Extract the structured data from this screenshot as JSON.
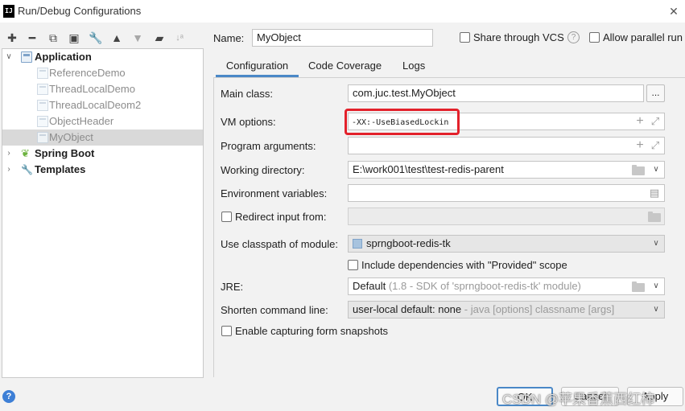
{
  "window": {
    "title": "Run/Debug Configurations",
    "app_icon_text": "IJ"
  },
  "toolbar": {
    "icons": [
      "plus-icon",
      "minus-icon",
      "copy-icon",
      "save-icon",
      "wrench-icon",
      "arrow-up-icon",
      "arrow-down-icon",
      "folder-add-icon",
      "sort-icon"
    ]
  },
  "tree": {
    "application": {
      "label": "Application",
      "children": [
        "ReferenceDemo",
        "ThreadLocalDemo",
        "ThreadLocalDeom2",
        "ObjectHeader",
        "MyObject"
      ]
    },
    "spring_boot": {
      "label": "Spring Boot"
    },
    "templates": {
      "label": "Templates"
    },
    "selected": "MyObject"
  },
  "header": {
    "name_label": "Name:",
    "name_value": "MyObject",
    "share_label": "Share through VCS",
    "parallel_label": "Allow parallel run",
    "help_glyph": "?"
  },
  "tabs": [
    "Configuration",
    "Code Coverage",
    "Logs"
  ],
  "form": {
    "main_class_label": "Main class:",
    "main_class_value": "com.juc.test.MyObject",
    "browse_label": "...",
    "vm_options_label": "VM options:",
    "vm_options_value": "-XX:-UseBiasedLockin",
    "program_args_label": "Program arguments:",
    "program_args_value": "",
    "working_dir_label": "Working directory:",
    "working_dir_value": "E:\\work001\\test\\test-redis-parent",
    "env_vars_label": "Environment variables:",
    "env_vars_value": "",
    "redirect_label": "Redirect input from:",
    "classpath_label": "Use classpath of module:",
    "classpath_value": "sprngboot-redis-tk",
    "include_deps_label": "Include dependencies with \"Provided\" scope",
    "jre_label": "JRE:",
    "jre_value": "Default",
    "jre_hint": "(1.8 - SDK of 'sprngboot-redis-tk' module)",
    "shorten_label": "Shorten command line:",
    "shorten_value": "user-local default: none",
    "shorten_hint": " - java [options] classname [args]",
    "snapshots_label": "Enable capturing form snapshots"
  },
  "footer": {
    "ok_label": "OK",
    "cancel_label": "Cancel",
    "apply_label": "Apply",
    "watermark": "CSDN @苹果香蕉西红柿",
    "help_glyph": "?"
  },
  "colors": {
    "accent": "#4a88c7",
    "highlight_box": "#e3212b",
    "selection": "#d9d9d9",
    "help_blue": "#3d7fd6"
  }
}
